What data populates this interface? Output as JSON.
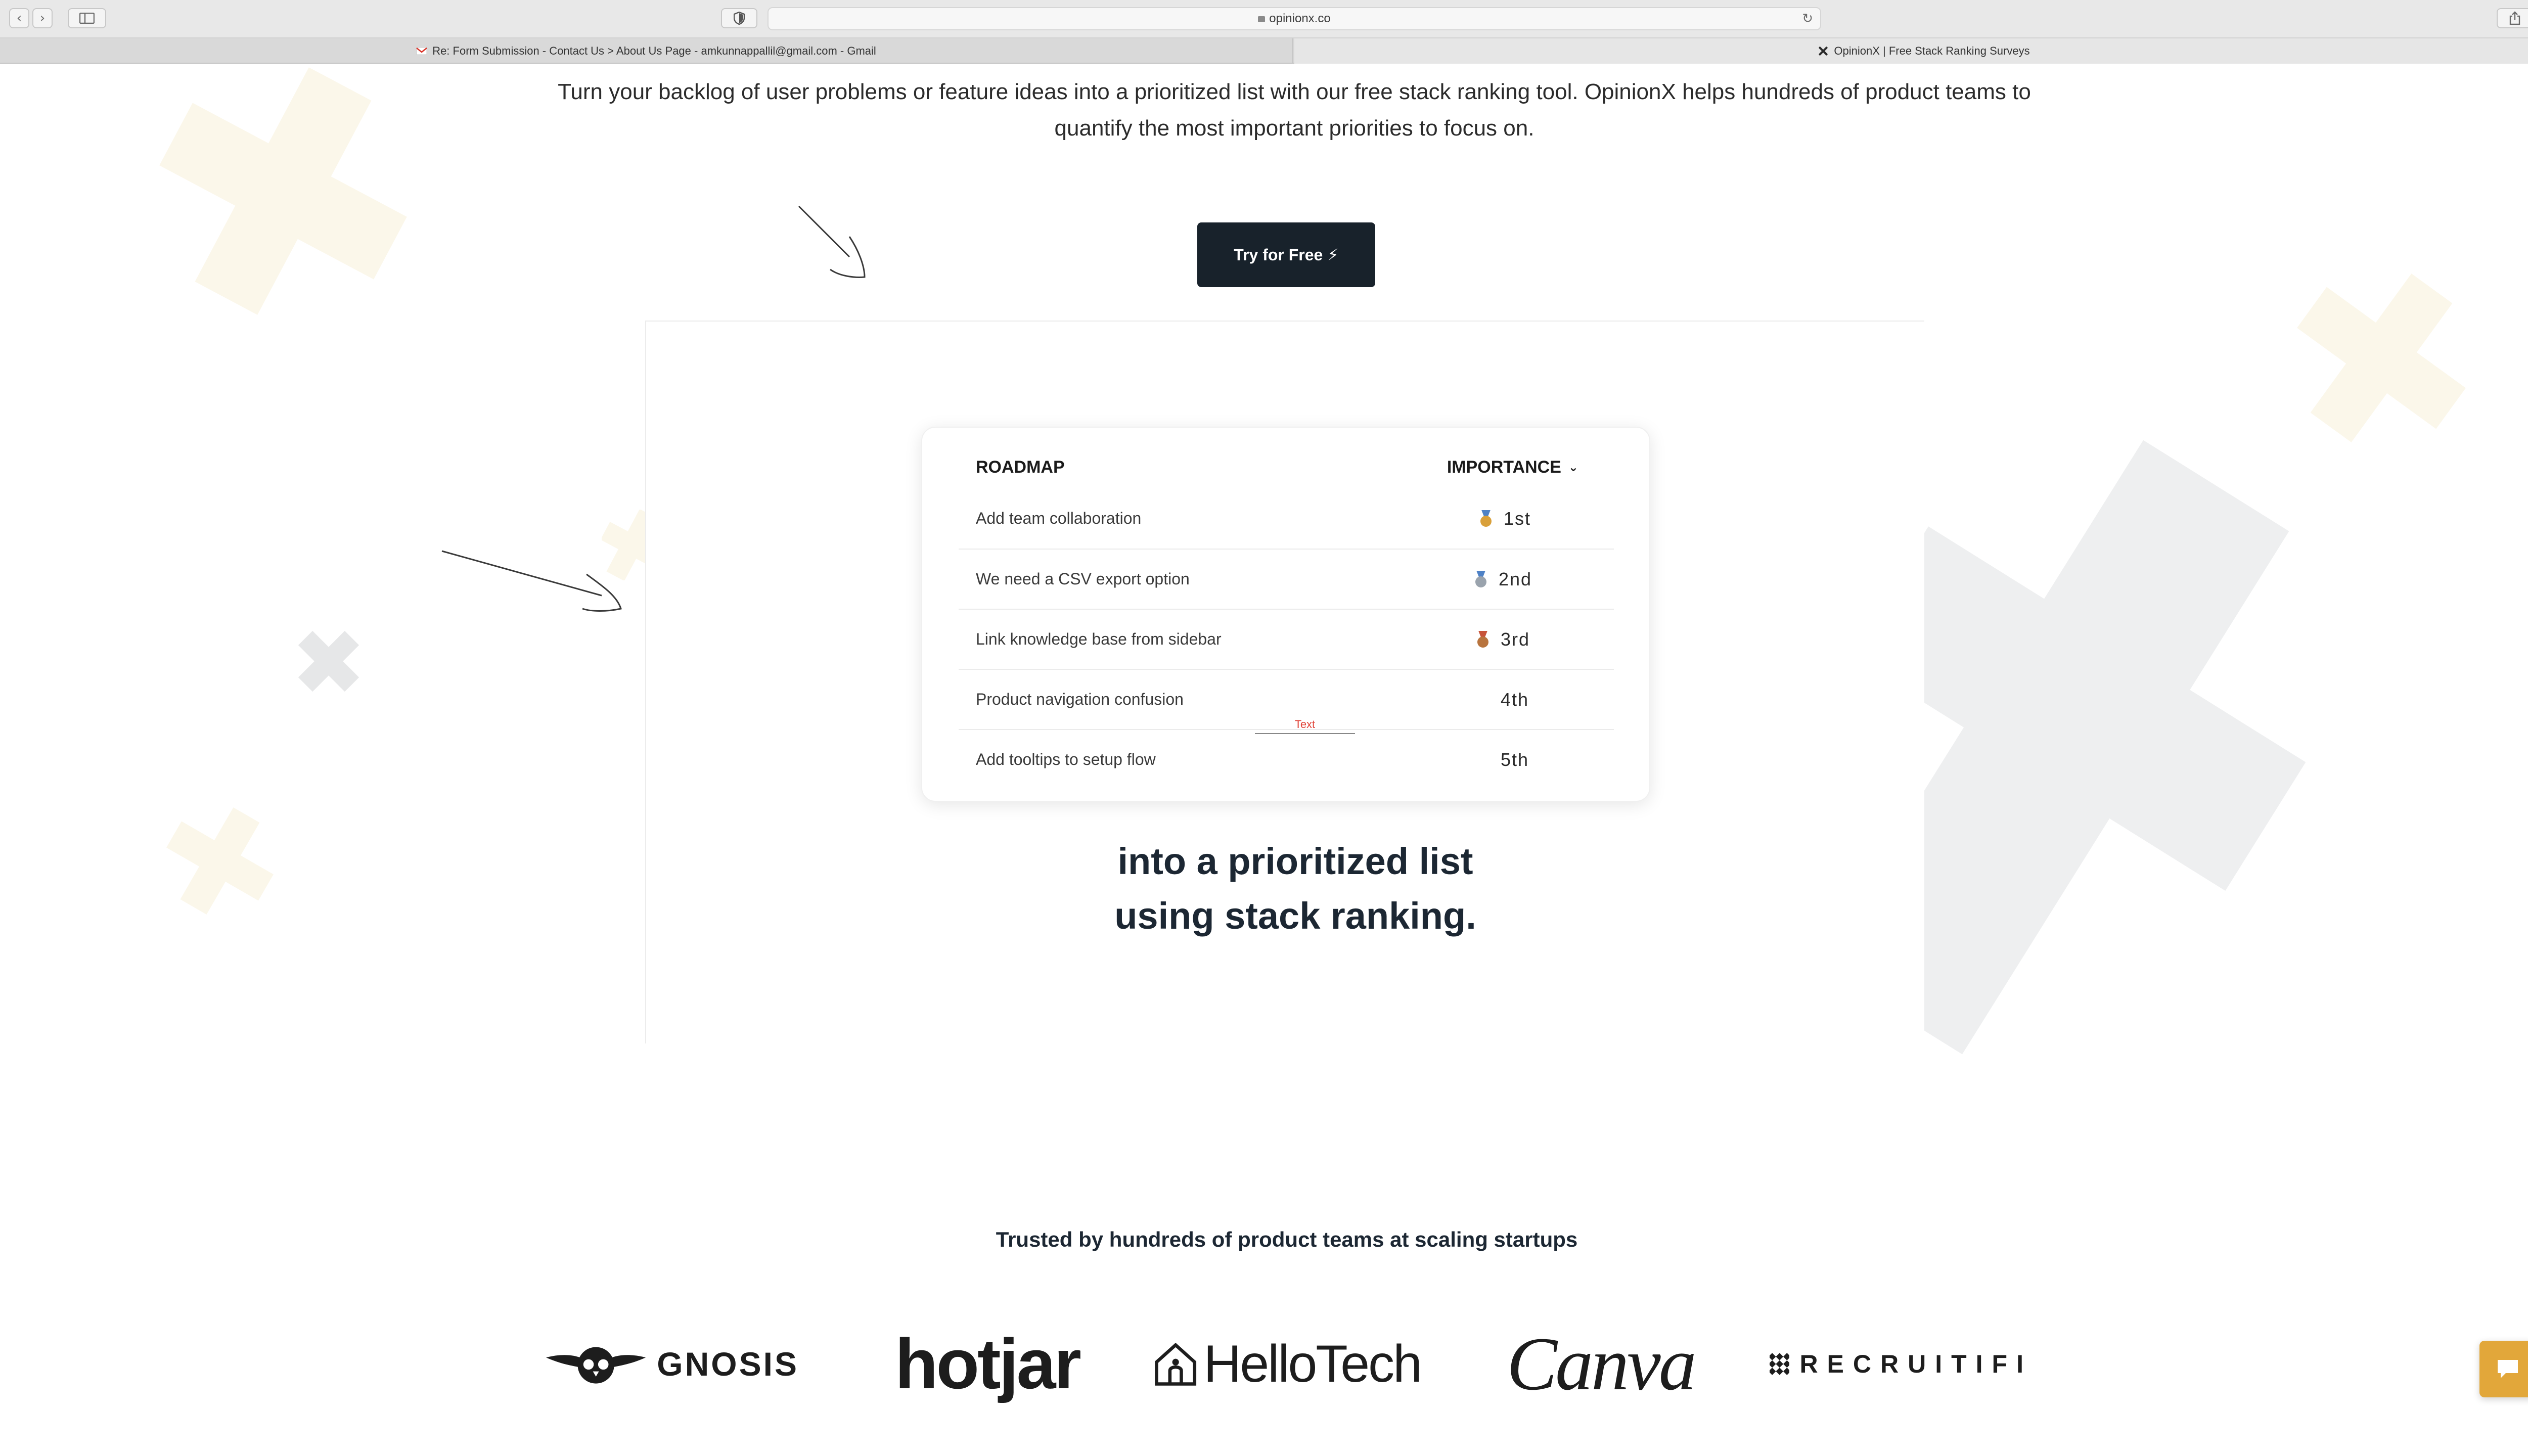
{
  "browser": {
    "url": "opinionx.co",
    "tabs": [
      {
        "label": "Re: Form Submission - Contact Us > About Us Page - amkunnappallil@gmail.com - Gmail",
        "active": false
      },
      {
        "label": "OpinionX | Free Stack Ranking Surveys",
        "active": true
      }
    ],
    "new_tab_glyph": "+",
    "reload_glyph": "↻",
    "back_glyph": "‹",
    "forward_glyph": "›"
  },
  "hero": {
    "intro": "Turn your backlog of user problems or feature ideas into a prioritized list with our free stack ranking tool. OpinionX helps hundreds of product teams to quantify the most important priorities to focus on.",
    "cta_label": "Try for Free ⚡"
  },
  "roadmap_card": {
    "col_left": "ROADMAP",
    "col_right": "IMPORTANCE",
    "chevron": "⌄",
    "rows": [
      {
        "item": "Add team collaboration",
        "rank": "1st",
        "medal": "gold"
      },
      {
        "item": "We need a CSV export option",
        "rank": "2nd",
        "medal": "silver"
      },
      {
        "item": "Link knowledge base from sidebar",
        "rank": "3rd",
        "medal": "bronze"
      },
      {
        "item": "Product navigation confusion",
        "rank": "4th",
        "medal": ""
      },
      {
        "item": "Add tooltips to setup flow",
        "rank": "5th",
        "medal": ""
      }
    ]
  },
  "text_marker": "Text",
  "headline": {
    "line1": "into a prioritized list",
    "line2": "using stack ranking."
  },
  "trusted": {
    "title": "Trusted by hundreds of product teams at scaling startups",
    "logos": [
      "GNOSIS",
      "hotjar",
      "HelloTech",
      "Canva",
      "RECRUITIFI"
    ]
  },
  "colors": {
    "cta_bg": "#18222b",
    "chat_accent": "#e2a73a",
    "decor_cream": "#fbf7ea",
    "decor_gray": "#eeeff0",
    "gold": "#d9a03a",
    "silver": "#9aa3ad",
    "bronze": "#b8743e"
  }
}
